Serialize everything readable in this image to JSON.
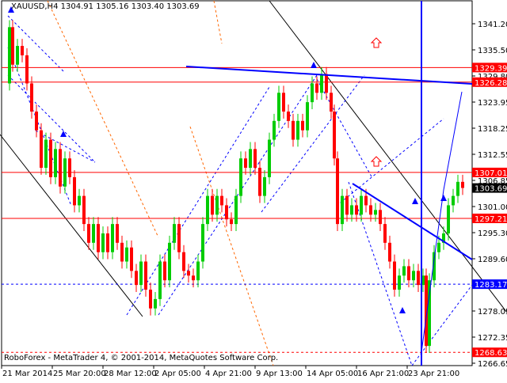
{
  "header": {
    "symbol": "XAUUSD,H4",
    "open": "1304.91",
    "high": "1305.16",
    "low": "1303.40",
    "close": "1303.69"
  },
  "footer": {
    "copyright": "RoboForex - MetaTrader 4, © 2001-2014, MetaQuotes Software Corp."
  },
  "chart_data": {
    "type": "candlestick",
    "title": "XAUUSD,H4",
    "ylim": [
      1265.8,
      1343.8
    ],
    "x_ticks": [
      "21 Mar 2014",
      "25 Mar 20:00",
      "28 Mar 12:00",
      "2 Apr 05:00",
      "4 Apr 21:00",
      "9 Apr 13:00",
      "14 Apr 05:00",
      "16 Apr 21:00",
      "23 Apr 21:00"
    ],
    "y_ticks": [
      "1341.20",
      "1335.50",
      "1329.80",
      "1323.95",
      "1318.25",
      "1312.55",
      "1306.85",
      "1301.00",
      "1295.30",
      "1289.60",
      "1283.90",
      "1278.05",
      "1272.35",
      "1266.65"
    ],
    "levels": [
      {
        "price": 1329.39,
        "label": "1329.39",
        "style": "solid-red"
      },
      {
        "price": 1326.28,
        "label": "1326.28",
        "style": "solid-red"
      },
      {
        "price": 1307.01,
        "label": "1307.01",
        "style": "solid-red"
      },
      {
        "price": 1297.21,
        "label": "1297.21",
        "style": "solid-red"
      },
      {
        "price": 1283.17,
        "label": "1283.17",
        "style": "dashed-blue"
      },
      {
        "price": 1268.63,
        "label": "1268.63",
        "style": "dashed-red"
      }
    ],
    "current_price": {
      "price": 1303.69,
      "label": "1303.69"
    },
    "price_path": [
      [
        0,
        1326
      ],
      [
        4,
        1338
      ],
      [
        8,
        1330
      ],
      [
        14,
        1334
      ],
      [
        20,
        1332
      ],
      [
        26,
        1326
      ],
      [
        32,
        1320
      ],
      [
        38,
        1316
      ],
      [
        44,
        1308
      ],
      [
        50,
        1314
      ],
      [
        56,
        1306
      ],
      [
        62,
        1312
      ],
      [
        68,
        1304
      ],
      [
        74,
        1310
      ],
      [
        80,
        1306
      ],
      [
        86,
        1300
      ],
      [
        92,
        1302
      ],
      [
        98,
        1296
      ],
      [
        104,
        1292
      ],
      [
        110,
        1296
      ],
      [
        116,
        1290
      ],
      [
        122,
        1294
      ],
      [
        128,
        1290
      ],
      [
        134,
        1296
      ],
      [
        140,
        1292
      ],
      [
        146,
        1288
      ],
      [
        152,
        1291
      ],
      [
        158,
        1286
      ],
      [
        164,
        1283
      ],
      [
        170,
        1288
      ],
      [
        176,
        1282
      ],
      [
        182,
        1278
      ],
      [
        188,
        1280
      ],
      [
        194,
        1288
      ],
      [
        200,
        1284
      ],
      [
        206,
        1292
      ],
      [
        212,
        1296
      ],
      [
        218,
        1290
      ],
      [
        224,
        1286
      ],
      [
        230,
        1285
      ],
      [
        236,
        1284
      ],
      [
        242,
        1288
      ],
      [
        248,
        1296
      ],
      [
        254,
        1302
      ],
      [
        260,
        1298
      ],
      [
        266,
        1302
      ],
      [
        272,
        1300
      ],
      [
        278,
        1297
      ],
      [
        284,
        1296
      ],
      [
        290,
        1302
      ],
      [
        296,
        1310
      ],
      [
        302,
        1308
      ],
      [
        308,
        1312
      ],
      [
        314,
        1308
      ],
      [
        320,
        1302
      ],
      [
        326,
        1306
      ],
      [
        332,
        1314
      ],
      [
        338,
        1318
      ],
      [
        344,
        1324
      ],
      [
        350,
        1320
      ],
      [
        356,
        1318
      ],
      [
        362,
        1314
      ],
      [
        368,
        1318
      ],
      [
        374,
        1316
      ],
      [
        380,
        1322
      ],
      [
        386,
        1326
      ],
      [
        392,
        1324
      ],
      [
        398,
        1328
      ],
      [
        404,
        1324
      ],
      [
        410,
        1320
      ],
      [
        414,
        1310
      ],
      [
        418,
        1296
      ],
      [
        424,
        1302
      ],
      [
        430,
        1298
      ],
      [
        436,
        1300
      ],
      [
        442,
        1298
      ],
      [
        448,
        1302
      ],
      [
        454,
        1300
      ],
      [
        460,
        1298
      ],
      [
        466,
        1299
      ],
      [
        472,
        1296
      ],
      [
        478,
        1292
      ],
      [
        484,
        1288
      ],
      [
        490,
        1282
      ],
      [
        496,
        1285
      ],
      [
        502,
        1287
      ],
      [
        508,
        1284
      ],
      [
        514,
        1286
      ],
      [
        520,
        1283
      ],
      [
        526,
        1285
      ],
      [
        530,
        1270
      ],
      [
        534,
        1284
      ],
      [
        540,
        1290
      ],
      [
        546,
        1292
      ],
      [
        552,
        1294
      ],
      [
        558,
        1300
      ],
      [
        564,
        1302
      ],
      [
        570,
        1305
      ],
      [
        576,
        1303.7
      ]
    ]
  }
}
